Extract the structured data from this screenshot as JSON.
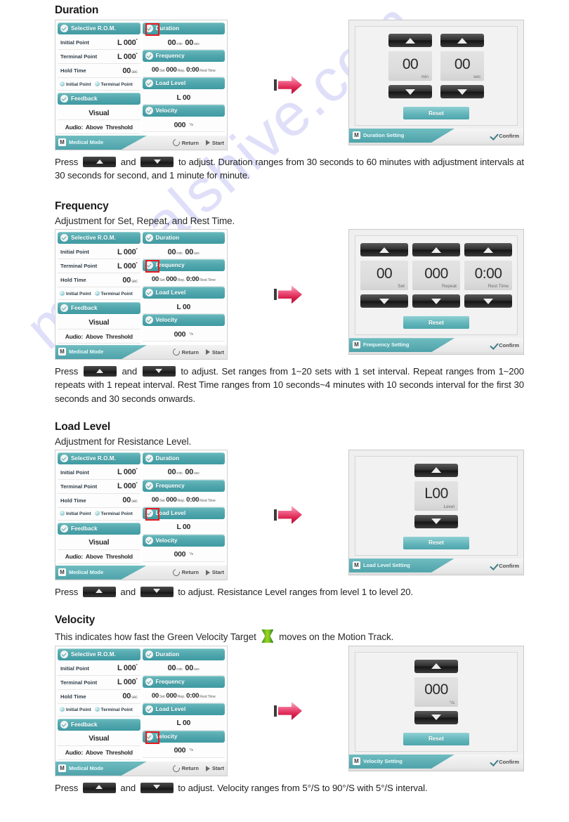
{
  "watermark": "manualshive.com",
  "device_screen": {
    "left_column": {
      "rom_tile": "Selective R.O.M.",
      "rows": [
        {
          "label": "Initial Point",
          "value": "L 000",
          "sup": "°",
          "unit": ""
        },
        {
          "label": "Terminal Point",
          "value": "L 000",
          "sup": "°",
          "unit": ""
        },
        {
          "label": "Hold Time",
          "value": "00",
          "sup": "",
          "unit": "sec"
        }
      ],
      "radios": [
        "Initial Point",
        "Terminal Point"
      ],
      "feedback_tile": "Feedback",
      "feedback_visual": "Visual",
      "feedback_audio_prefix": "Audio:",
      "feedback_audio_bold": "Above",
      "feedback_audio_suffix": "Threshold"
    },
    "right_column": {
      "duration_tile": "Duration",
      "duration_min": "00",
      "duration_min_unit": "min",
      "duration_sec": "00",
      "duration_sec_unit": "sec",
      "frequency_tile": "Frequency",
      "freq_set": "00",
      "freq_set_unit": "Set",
      "freq_rep": "000",
      "freq_rep_unit": "Rep.",
      "freq_rest": "0:00",
      "freq_rest_unit": "Rest Time",
      "load_tile": "Load Level",
      "load_value": "L 00",
      "velocity_tile": "Velocity",
      "velocity_value": "000",
      "velocity_unit": "°/s"
    },
    "bottom_bar": {
      "mode_badge": "M",
      "mode_label": "Medical Mode",
      "return_label": "Return",
      "start_label": "Start"
    }
  },
  "sections": [
    {
      "id": "duration",
      "title": "Duration",
      "subtitle": "",
      "setting": {
        "badge": "M",
        "title": "Duration Setting",
        "confirm": "Confirm",
        "reset": "Reset",
        "spinners": [
          {
            "value": "00",
            "unit": "min"
          },
          {
            "value": "00",
            "unit": "sec"
          }
        ]
      },
      "body_pre": "Press",
      "body_mid": "and",
      "body_post": "to adjust. Duration ranges from 30 seconds to 60 minutes with adjustment intervals at 30 seconds for second, and 1 minute for minute."
    },
    {
      "id": "frequency",
      "title": "Frequency",
      "subtitle": "Adjustment for Set, Repeat, and Rest Time.",
      "setting": {
        "badge": "M",
        "title": "Frequency Setting",
        "confirm": "Confirm",
        "reset": "Reset",
        "spinners": [
          {
            "value": "00",
            "unit": "Set"
          },
          {
            "value": "000",
            "unit": "Repeat"
          },
          {
            "value": "0:00",
            "unit": "Rest Time"
          }
        ]
      },
      "body_pre": "Press",
      "body_mid": "and",
      "body_post": "to adjust. Set ranges from 1~20 sets with 1 set interval. Repeat ranges from 1~200 repeats with 1 repeat interval. Rest Time ranges from 10 seconds~4 minutes with 10 seconds interval for the first 30 seconds and 30 seconds onwards."
    },
    {
      "id": "load-level",
      "title": "Load Level",
      "subtitle": "Adjustment for Resistance Level.",
      "setting": {
        "badge": "M",
        "title": "Load Level Setting",
        "confirm": "Confirm",
        "reset": "Reset",
        "spinners": [
          {
            "value": "L00",
            "unit": "Level"
          }
        ]
      },
      "body_pre": "Press",
      "body_mid": "and",
      "body_post": "to adjust. Resistance Level ranges from level 1 to level 20."
    },
    {
      "id": "velocity",
      "title": "Velocity",
      "subtitle_pre": "This indicates how fast the Green Velocity Target",
      "subtitle_post": "moves on the Motion Track.",
      "setting": {
        "badge": "M",
        "title": "Velocity Setting",
        "confirm": "Confirm",
        "reset": "Reset",
        "spinners": [
          {
            "value": "000",
            "unit": "°/s"
          }
        ]
      },
      "body_pre": "Press",
      "body_mid": "and",
      "body_post": "to adjust. Velocity ranges from 5°/S to 90°/S with 5°/S interval."
    }
  ]
}
